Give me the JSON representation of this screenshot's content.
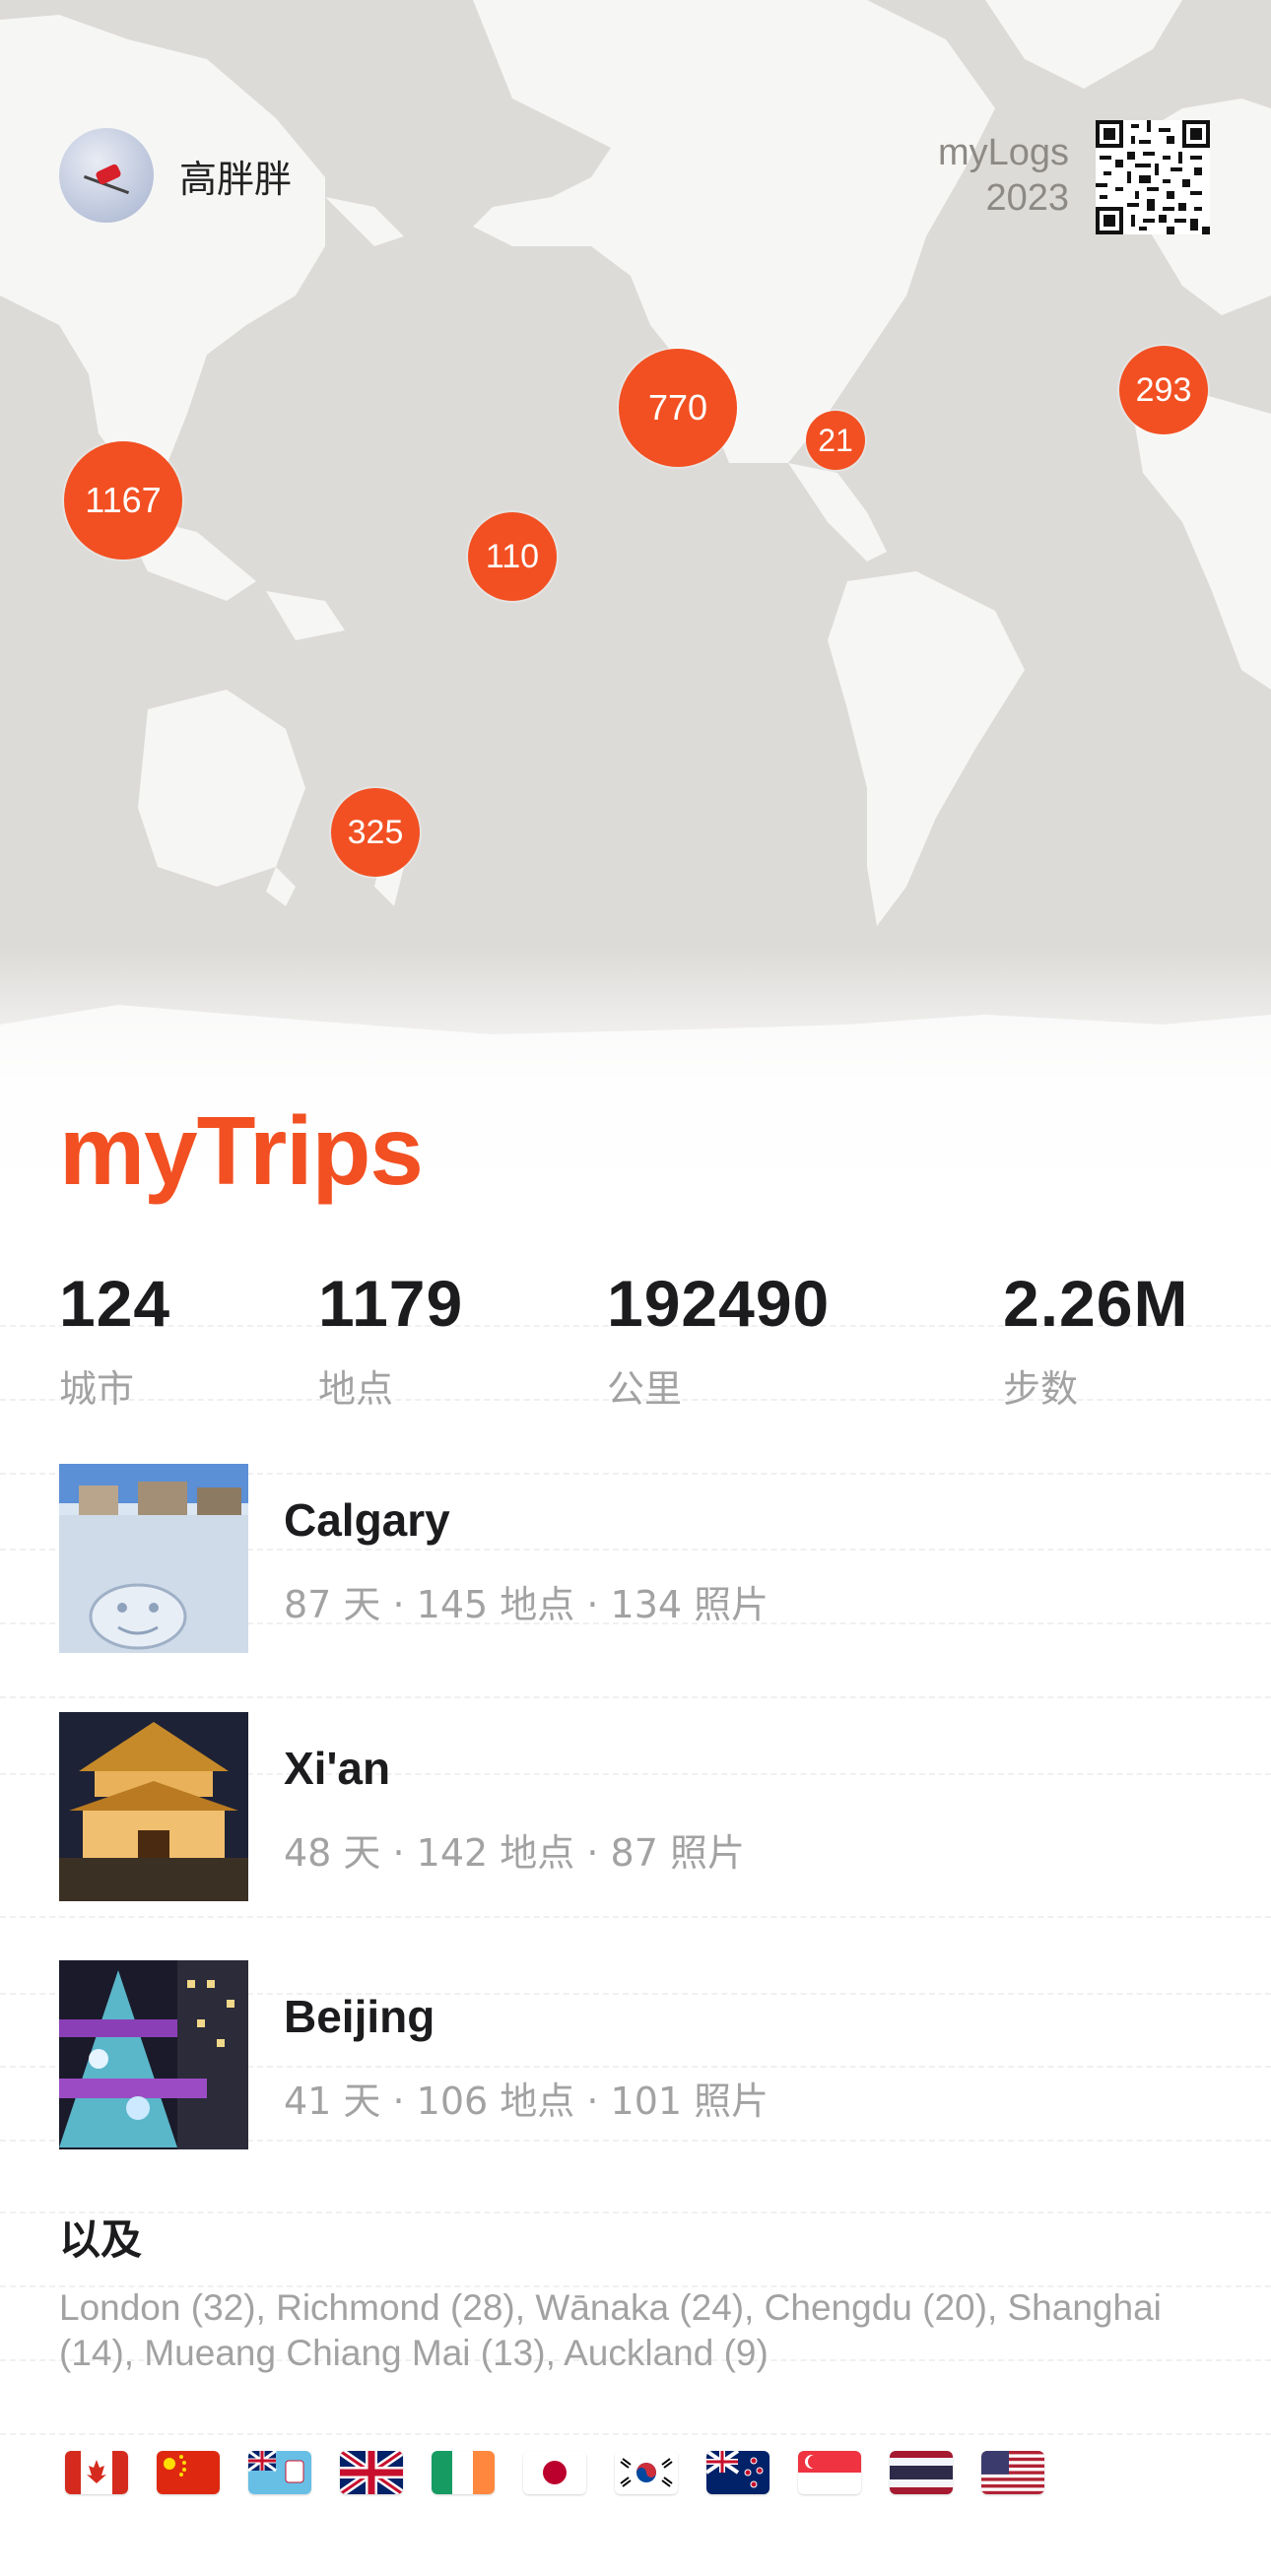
{
  "user": {
    "name": "高胖胖"
  },
  "brand": {
    "line1": "myLogs",
    "line2": "2023"
  },
  "accent_color": "#f25022",
  "map": {
    "clusters": [
      {
        "label": "1167"
      },
      {
        "label": "770"
      },
      {
        "label": "21"
      },
      {
        "label": "293"
      },
      {
        "label": "110"
      },
      {
        "label": "325"
      }
    ]
  },
  "title": "myTrips",
  "stats": [
    {
      "value": "124",
      "label": "城市"
    },
    {
      "value": "1179",
      "label": "地点"
    },
    {
      "value": "192490",
      "label": "公里"
    },
    {
      "value": "2.26M",
      "label": "步数"
    }
  ],
  "cities": [
    {
      "name": "Calgary",
      "meta": "87 天 · 145 地点 · 134 照片"
    },
    {
      "name": "Xi'an",
      "meta": "48 天 · 142 地点 · 87 照片"
    },
    {
      "name": "Beijing",
      "meta": "41 天 · 106 地点 · 101 照片"
    }
  ],
  "also": {
    "title": "以及",
    "text": "London (32), Richmond (28), Wānaka (24), Chengdu (20), Shanghai (14), Mueang Chiang Mai (13), Auckland (9)"
  },
  "flags": [
    "canada-flag-icon",
    "china-flag-icon",
    "fiji-flag-icon",
    "uk-flag-icon",
    "ireland-flag-icon",
    "japan-flag-icon",
    "south-korea-flag-icon",
    "new-zealand-flag-icon",
    "singapore-flag-icon",
    "thailand-flag-icon",
    "usa-flag-icon"
  ]
}
